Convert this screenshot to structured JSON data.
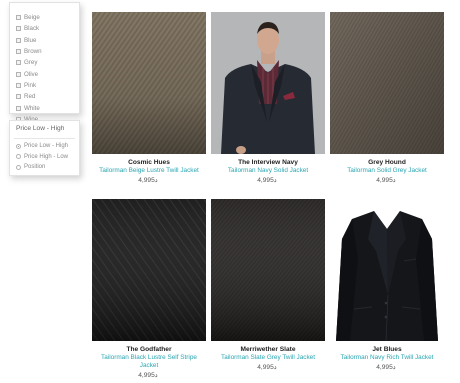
{
  "filters": {
    "colors": [
      "Beige",
      "Black",
      "Blue",
      "Brown",
      "Grey",
      "Olive",
      "Pink",
      "Red",
      "White",
      "Wine"
    ],
    "sort": {
      "selected": "Price Low - High",
      "options": [
        {
          "label": "Price Low - High",
          "checked": true
        },
        {
          "label": "Price High - Low",
          "checked": false
        },
        {
          "label": "Position",
          "checked": false
        }
      ]
    }
  },
  "currency_symbol": "د",
  "products": [
    {
      "name": "Cosmic Hues",
      "desc": "Tailorman Beige Lustre Twill Jacket",
      "price": "4,995",
      "image": "fabric-beige"
    },
    {
      "name": "The Interview Navy",
      "desc": "Tailorman Navy Solid Jacket",
      "price": "4,995",
      "image": "model-navy-jacket"
    },
    {
      "name": "Grey Hound",
      "desc": "Tailorman Solid Grey Jacket",
      "price": "4,995",
      "image": "fabric-grey"
    },
    {
      "name": "The Godfather",
      "desc": "Tailorman Black Lustre Self Stripe Jacket",
      "price": "4,995",
      "image": "fabric-black-stripe"
    },
    {
      "name": "Merriwether Slate",
      "desc": "Tailorman Slate Grey Twill Jacket",
      "price": "4,995",
      "image": "fabric-slate"
    },
    {
      "name": "Jet Blues",
      "desc": "Tailorman Navy Rich Twill Jacket",
      "price": "4,995",
      "image": "jacket-navy"
    }
  ]
}
